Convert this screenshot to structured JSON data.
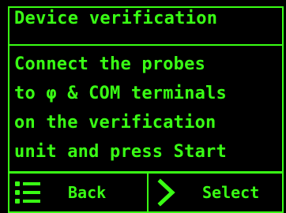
{
  "header": {
    "title": "Device verification"
  },
  "instructions": {
    "lines": [
      "Connect the probes",
      "to φ & COM terminals",
      "on the verification",
      "unit and press Start"
    ]
  },
  "footer": {
    "back": {
      "label": "Back",
      "icon": "menu-list-icon"
    },
    "select": {
      "label": "Select",
      "icon": "chevron-right-icon"
    }
  },
  "colors": {
    "foreground": "#39ff14",
    "background": "#000000"
  }
}
